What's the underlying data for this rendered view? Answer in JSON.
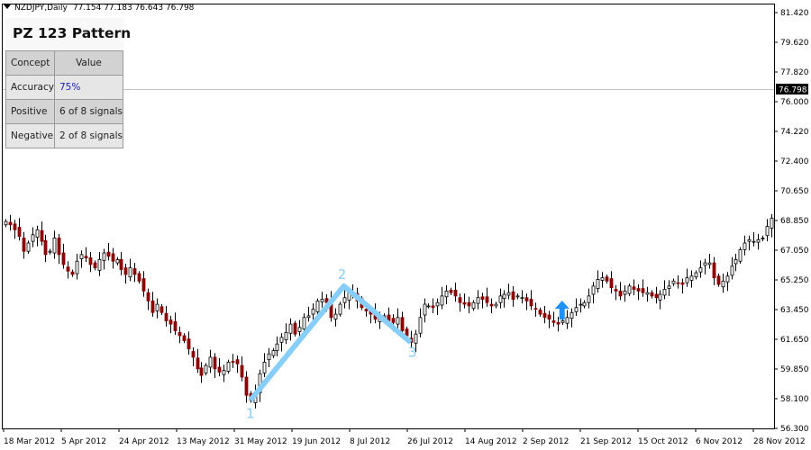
{
  "header": {
    "symbol": "NZDJPY,Daily",
    "ohlc": "77.154 77.183 76.643 76.798"
  },
  "panel": {
    "title": "PZ 123 Pattern",
    "columns": [
      "Concept",
      "Value"
    ],
    "rows": [
      {
        "concept": "Accuracy",
        "value": "75%"
      },
      {
        "concept": "Positive",
        "value": "6 of 8 signals"
      },
      {
        "concept": "Negative",
        "value": "2 of 8 signals"
      }
    ]
  },
  "price_axis": {
    "ticks": [
      "81.420",
      "79.620",
      "77.820",
      "76.000",
      "74.220",
      "72.400",
      "70.650",
      "68.850",
      "67.050",
      "65.250",
      "63.450",
      "61.650",
      "59.850",
      "58.100",
      "56.300"
    ],
    "current_price": "76.798"
  },
  "time_axis": {
    "labels": [
      "18 Mar 2012",
      "5 Apr 2012",
      "24 Apr 2012",
      "13 May 2012",
      "31 May 2012",
      "19 Jun 2012",
      "8 Jul 2012",
      "26 Jul 2012",
      "14 Aug 2012",
      "2 Sep 2012",
      "21 Sep 2012",
      "15 Oct 2012",
      "6 Nov 2012",
      "28 Nov 2012"
    ]
  },
  "pattern": {
    "labels": [
      "1",
      "2",
      "3"
    ],
    "line_color": "#87cefa",
    "arrow_color": "#1e90ff"
  },
  "colors": {
    "bull": "#ffffff",
    "bear": "#8b0000",
    "wick": "#000000",
    "grid": "#c0c0c0",
    "price_tag_bg": "#000000"
  },
  "chart_data": {
    "type": "candlestick",
    "ylim": [
      56.3,
      81.42
    ],
    "series_close": [
      68.8,
      68.6,
      68.3,
      67.9,
      67.0,
      67.5,
      68.0,
      68.3,
      67.6,
      66.8,
      67.0,
      67.8,
      66.8,
      66.2,
      65.8,
      65.6,
      66.4,
      66.8,
      66.6,
      66.2,
      66.0,
      66.5,
      66.9,
      66.7,
      66.4,
      66.5,
      65.9,
      65.6,
      66.0,
      65.6,
      65.2,
      64.6,
      64.0,
      63.3,
      63.8,
      63.3,
      62.8,
      62.6,
      62.2,
      61.9,
      61.6,
      61.1,
      60.6,
      59.9,
      59.5,
      60.1,
      60.6,
      59.9,
      59.7,
      59.8,
      60.3,
      60.3,
      60.2,
      59.4,
      58.3,
      58.0,
      58.5,
      59.6,
      60.3,
      60.8,
      61.0,
      61.4,
      61.8,
      62.1,
      62.6,
      62.0,
      62.4,
      63.0,
      63.1,
      63.5,
      64.0,
      64.1,
      63.9,
      63.0,
      63.2,
      63.8,
      64.2,
      64.5,
      64.4,
      64.0,
      63.6,
      63.4,
      63.2,
      62.9,
      63.0,
      63.1,
      62.8,
      62.7,
      63.0,
      62.2,
      61.9,
      61.5,
      62.0,
      63.0,
      63.8,
      63.7,
      63.6,
      63.9,
      64.3,
      64.6,
      64.5,
      64.3,
      63.9,
      63.8,
      63.7,
      63.9,
      64.2,
      64.1,
      63.9,
      63.7,
      63.8,
      64.3,
      64.4,
      64.5,
      64.1,
      64.3,
      64.2,
      64.0,
      63.7,
      63.5,
      63.2,
      63.0,
      62.9,
      62.7,
      62.6,
      62.8,
      63.0,
      63.3,
      63.6,
      63.8,
      63.9,
      64.3,
      64.9,
      65.3,
      65.4,
      65.2,
      64.8,
      64.6,
      64.3,
      64.6,
      64.9,
      64.7,
      64.6,
      64.5,
      64.5,
      64.3,
      64.2,
      64.4,
      64.7,
      64.9,
      65.2,
      65.1,
      65.0,
      65.4,
      65.5,
      65.7,
      66.0,
      66.3,
      66.3,
      65.4,
      65.0,
      65.2,
      65.5,
      66.1,
      66.5,
      67.1,
      67.5,
      67.7,
      67.6,
      67.7,
      67.8,
      68.5,
      69.0
    ],
    "pattern_points": [
      {
        "label": "1",
        "value": 58.0
      },
      {
        "label": "2",
        "value": 64.9
      },
      {
        "label": "3",
        "value": 61.5
      }
    ],
    "signal": {
      "type": "buy-arrow"
    }
  }
}
